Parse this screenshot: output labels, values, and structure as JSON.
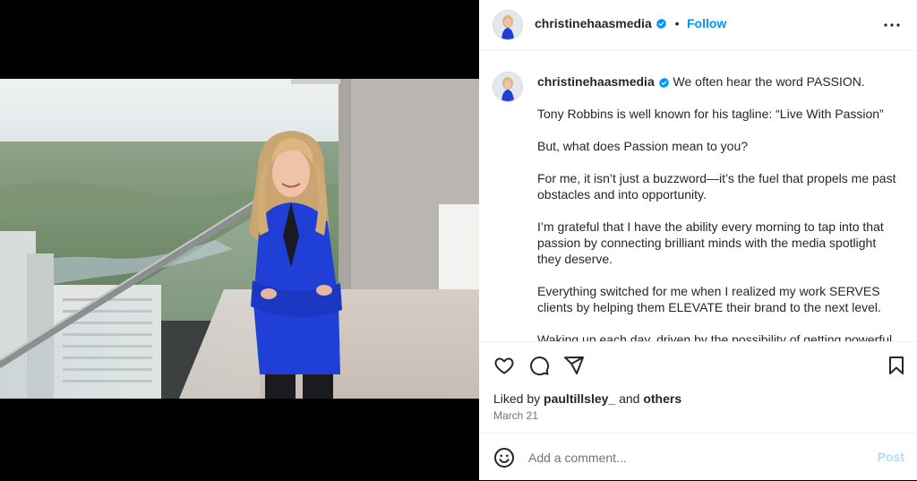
{
  "post": {
    "author": "christinehaasmedia",
    "follow_label": "Follow",
    "separator": "•",
    "caption_first": "We often hear the word PASSION.",
    "caption_paragraphs": [
      "Tony Robbins is well known for his tagline: “Live With Passion”",
      "But, what does Passion mean to you?",
      "For me, it isn’t just a buzzword—it’s the fuel that propels me past obstacles and into opportunity.",
      "I’m grateful that I have the ability every morning to tap into that passion by connecting brilliant minds with the media spotlight they deserve.",
      "Everything switched for me when I realized my work SERVES clients by helping them ELEVATE their brand to the next level.",
      "Waking up each day, driven by the possibility of getting powerful"
    ],
    "liked_prefix": "Liked by",
    "liked_user": "paultillsley_",
    "liked_and": "and",
    "liked_others": "others",
    "date": "March 21"
  },
  "comment": {
    "placeholder": "Add a comment...",
    "post_label": "Post"
  },
  "icons": {
    "header_more": "more-horizontal-icon",
    "like": "heart-icon",
    "comment": "comment-bubble-icon",
    "share": "paper-plane-icon",
    "save": "bookmark-icon",
    "emoji": "smiley-icon",
    "verified": "verified-badge-icon"
  },
  "colors": {
    "accent": "#0095f6",
    "post_disabled": "#b3dbff",
    "blazer": "#1f3fd6"
  }
}
